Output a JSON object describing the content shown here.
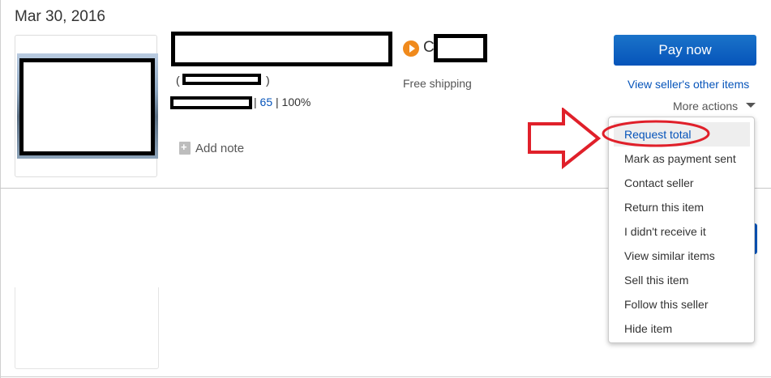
{
  "order": {
    "date": "Mar 30, 2016",
    "feedback_paren_open": "(",
    "feedback_paren_close": ")",
    "feedback_count": "65",
    "feedback_percent": "| 100%",
    "feedback_sep": "|",
    "add_note_label": "Add note",
    "seller_initial": "C",
    "shipping": "Free shipping"
  },
  "actions": {
    "pay_now_label": "Pay now",
    "seller_items_label": "View seller's other items",
    "more_actions_label": "More actions"
  },
  "more_actions_menu": {
    "items": [
      "Request total",
      "Mark as payment sent",
      "Contact seller",
      "Return this item",
      "I didn't receive it",
      "View similar items",
      "Sell this item",
      "Follow this seller",
      "Hide item"
    ],
    "highlighted_item": "Request total"
  },
  "annotations": {
    "arrow_color": "#e0202a",
    "circle_color": "#e0202a"
  },
  "colors": {
    "link": "#0654ba",
    "pay_button": "#0654ba",
    "seller_icon": "#f08a1c"
  }
}
